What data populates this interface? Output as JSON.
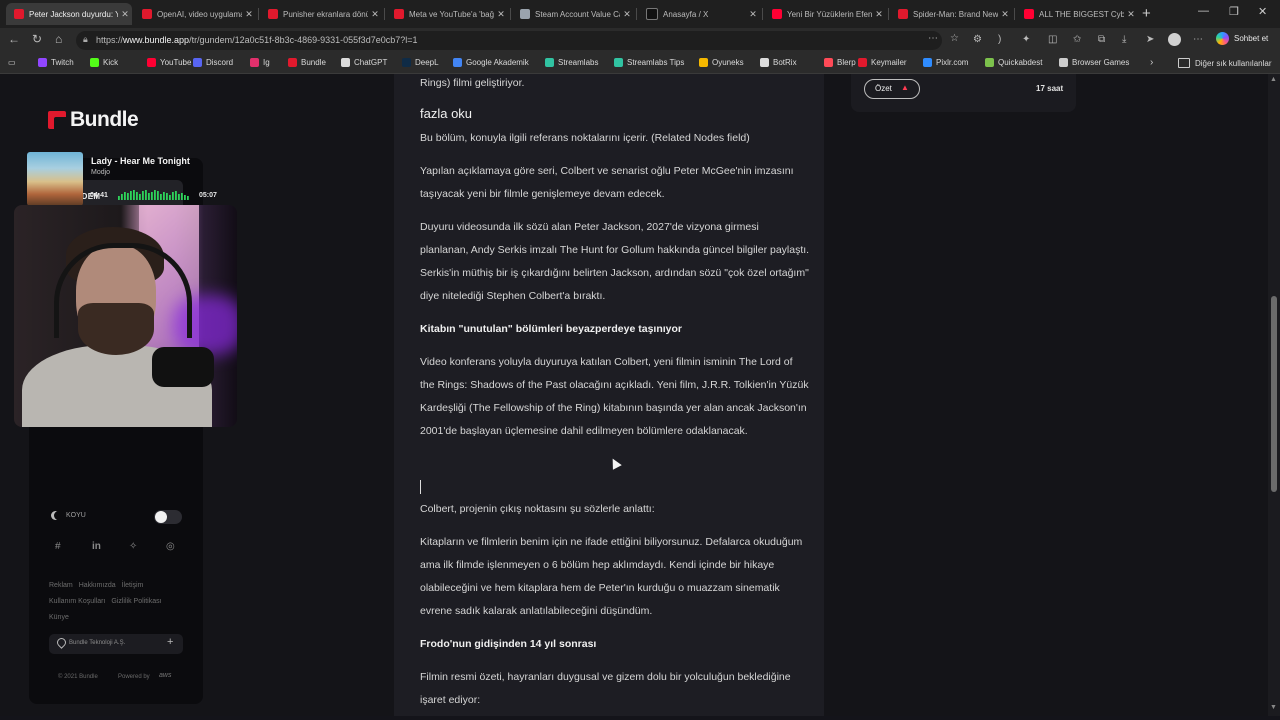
{
  "browser": {
    "tabs": [
      {
        "title": "Peter Jackson duyurdu: Y",
        "color": "#e1192d",
        "active": true
      },
      {
        "title": "OpenAI, video uygulama",
        "color": "#e1192d",
        "active": false
      },
      {
        "title": "Punisher ekranlara dönü",
        "color": "#e1192d",
        "active": false
      },
      {
        "title": "Meta ve YouTube'a 'bağı",
        "color": "#e1192d",
        "active": false
      },
      {
        "title": "Steam Account Value Ca",
        "color": "#9aa3ad",
        "active": false
      },
      {
        "title": "Anasayfa / X",
        "color": "#111111",
        "active": false
      },
      {
        "title": "Yeni Bir Yüzüklerin Efend",
        "color": "#ff0033",
        "active": false
      },
      {
        "title": "Spider-Man: Brand New",
        "color": "#e1192d",
        "active": false
      },
      {
        "title": "ALL THE BIGGEST Cyber",
        "color": "#ff0033",
        "active": false
      }
    ],
    "close_glyph": "✕",
    "new_tab_glyph": "+",
    "window_controls": {
      "minimize": "—",
      "restore": "❐",
      "close": "✕"
    },
    "url_scheme_host": "https://",
    "url_domain": "www.bundle.app",
    "url_path": "/tr/gundem/12a0c51f-8b3c-4869-9331-055f3d7e0cb7?l=1",
    "copilot_label": "Sohbet et"
  },
  "bookmarks": [
    {
      "label": "Twitch",
      "color": "#9146ff"
    },
    {
      "label": "Kick",
      "color": "#53fc18"
    },
    {
      "label": "YouTube",
      "color": "#ff0033"
    },
    {
      "label": "Discord",
      "color": "#5865f2"
    },
    {
      "label": "Ig",
      "color": "#e1306c"
    },
    {
      "label": "Bundle",
      "color": "#e1192d"
    },
    {
      "label": "ChatGPT",
      "color": "#dcdcdc"
    },
    {
      "label": "DeepL",
      "color": "#0f2b46"
    },
    {
      "label": "Google Akademik",
      "color": "#4285f4"
    },
    {
      "label": "Streamlabs",
      "color": "#31c3a2"
    },
    {
      "label": "Streamlabs Tips",
      "color": "#31c3a2"
    },
    {
      "label": "Oyuneks",
      "color": "#f5b800"
    },
    {
      "label": "BotRix",
      "color": "#dddddd"
    },
    {
      "label": "Blerp",
      "color": "#ff4a57"
    },
    {
      "label": "Keymailer",
      "color": "#e1192d"
    },
    {
      "label": "Pixlr.com",
      "color": "#2f8cff"
    },
    {
      "label": "Quickabdest",
      "color": "#7cc14c"
    },
    {
      "label": "Browser Games",
      "color": "#cccccc"
    }
  ],
  "bookmarks_more": "›",
  "other_bookmarks": "Diğer sık kullanılanlar",
  "sidebar": {
    "logo": "Bundle",
    "nav_active": "GÜNDEM",
    "dark_mode_label": "KOYU",
    "footer_links": [
      "Reklam",
      "Hakkımızda",
      "İletişim",
      "Kullanım Koşulları",
      "Gizlilik Politikası",
      "Künye"
    ],
    "company": "Bundle Teknoloji A.Ş.",
    "company_plus": "+",
    "copyright": "© 2021 Bundle",
    "powered_by": "Powered by",
    "aws": "aws",
    "social_icons": [
      "slack-icon",
      "linkedin-icon",
      "twitter-icon",
      "instagram-icon"
    ]
  },
  "music": {
    "title": "Lady - Hear Me Tonight",
    "artist": "Modjo",
    "elapsed": "04:41",
    "total": "05:07",
    "bar_color": "#2ed35a"
  },
  "article": {
    "top_fragment": "Rings) filmi geliştiriyor.",
    "more_label": "fazla oku",
    "related_note": "Bu bölüm, konuyla ilgili referans noktalarını içerir. (Related Nodes field)",
    "p1": "Yapılan açıklamaya göre seri, Colbert ve senarist oğlu Peter McGee'nin imzasını taşıyacak yeni bir filmle genişlemeye devam edecek.",
    "p2": "Duyuru videosunda ilk sözü alan Peter Jackson, 2027'de vizyona girmesi planlanan, Andy Serkis imzalı The Hunt for Gollum hakkında güncel bilgiler paylaştı. Serkis'in müthiş bir iş çıkardığını belirten Jackson, ardından sözü \"çok özel ortağım\" diye nitelediği Stephen Colbert'a bıraktı.",
    "h1": "Kitabın \"unutulan\" bölümleri beyazperdeye taşınıyor",
    "p3": "Video konferans yoluyla duyuruya katılan Colbert, yeni filmin isminin The Lord of the Rings: Shadows of the Past olacağını açıkladı. Yeni film, J.R.R. Tolkien'in Yüzük Kardeşliği (The Fellowship of the Ring) kitabının başında yer alan ancak Jackson'ın 2001'de başlayan üçlemesine dahil edilmeyen bölümlere odaklanacak.",
    "p4": "Colbert, projenin çıkış noktasını şu sözlerle anlattı:",
    "p5": "Kitapların ve filmlerin benim için ne ifade ettiğini biliyorsunuz. Defalarca okuduğum ama ilk filmde işlenmeyen o 6 bölüm hep aklımdaydı. Kendi içinde bir hikaye olabileceğini ve hem kitaplara hem de Peter'ın kurduğu o muazzam sinematik evrene sadık kalarak anlatılabileceğini düşündüm.",
    "h2": "Frodo'nun gidişinden 14 yıl sonrası",
    "p6": "Filmin resmi özeti, hayranları duygusal ve gizem dolu bir yolculuğun beklediğine işaret ediyor:"
  },
  "right_panel": {
    "summary_label": "Özet",
    "summary_icon": "fire-icon",
    "time_ago": "17 saat"
  },
  "colors": {
    "accent": "#e1192d",
    "page_bg": "#141418",
    "article_bg": "#1d1d23"
  }
}
